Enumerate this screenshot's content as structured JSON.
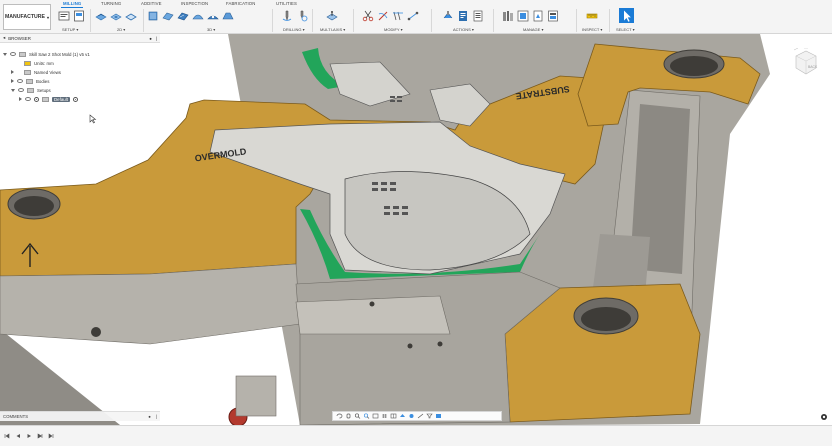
{
  "ribbon": {
    "workspace_label": "MANUFACTURE",
    "tabs": [
      {
        "label": "MILLING",
        "active": true
      },
      {
        "label": "TURNING",
        "active": false
      },
      {
        "label": "ADDITIVE",
        "active": false
      },
      {
        "label": "INSPECTION",
        "active": false
      },
      {
        "label": "FABRICATION",
        "active": false
      },
      {
        "label": "UTILITIES",
        "active": false
      }
    ],
    "groups": [
      "SETUP",
      "2D",
      "3D",
      "DRILLING",
      "MULTI-AXIS",
      "MODIFY",
      "ACTIONS",
      "MANAGE",
      "INSPECT",
      "SELECT"
    ]
  },
  "browser": {
    "title": "BROWSER",
    "items": [
      {
        "label": "Skill Saw 2 Shot Mold (1) v5 v1",
        "icon": "document-icon"
      },
      {
        "label": "Units: mm",
        "icon": "document-icon"
      },
      {
        "label": "Named Views",
        "icon": "folder-icon"
      },
      {
        "label": "Bodies",
        "icon": "folder-icon"
      },
      {
        "label": "Setups",
        "icon": "folder-icon"
      },
      {
        "label": "Default",
        "icon": "setup-icon"
      }
    ]
  },
  "model": {
    "labels": {
      "overmold": "OVERMOLD",
      "substrate": "SUBSTRATE"
    }
  },
  "viewcube": {
    "face_label": "BACK"
  },
  "comments": {
    "title": "COMMENTS"
  },
  "colors": {
    "accent": "#1a7bd6",
    "plate": "#c99a3a",
    "steel": "#a6a39c",
    "overmold_green": "#22a55a"
  }
}
